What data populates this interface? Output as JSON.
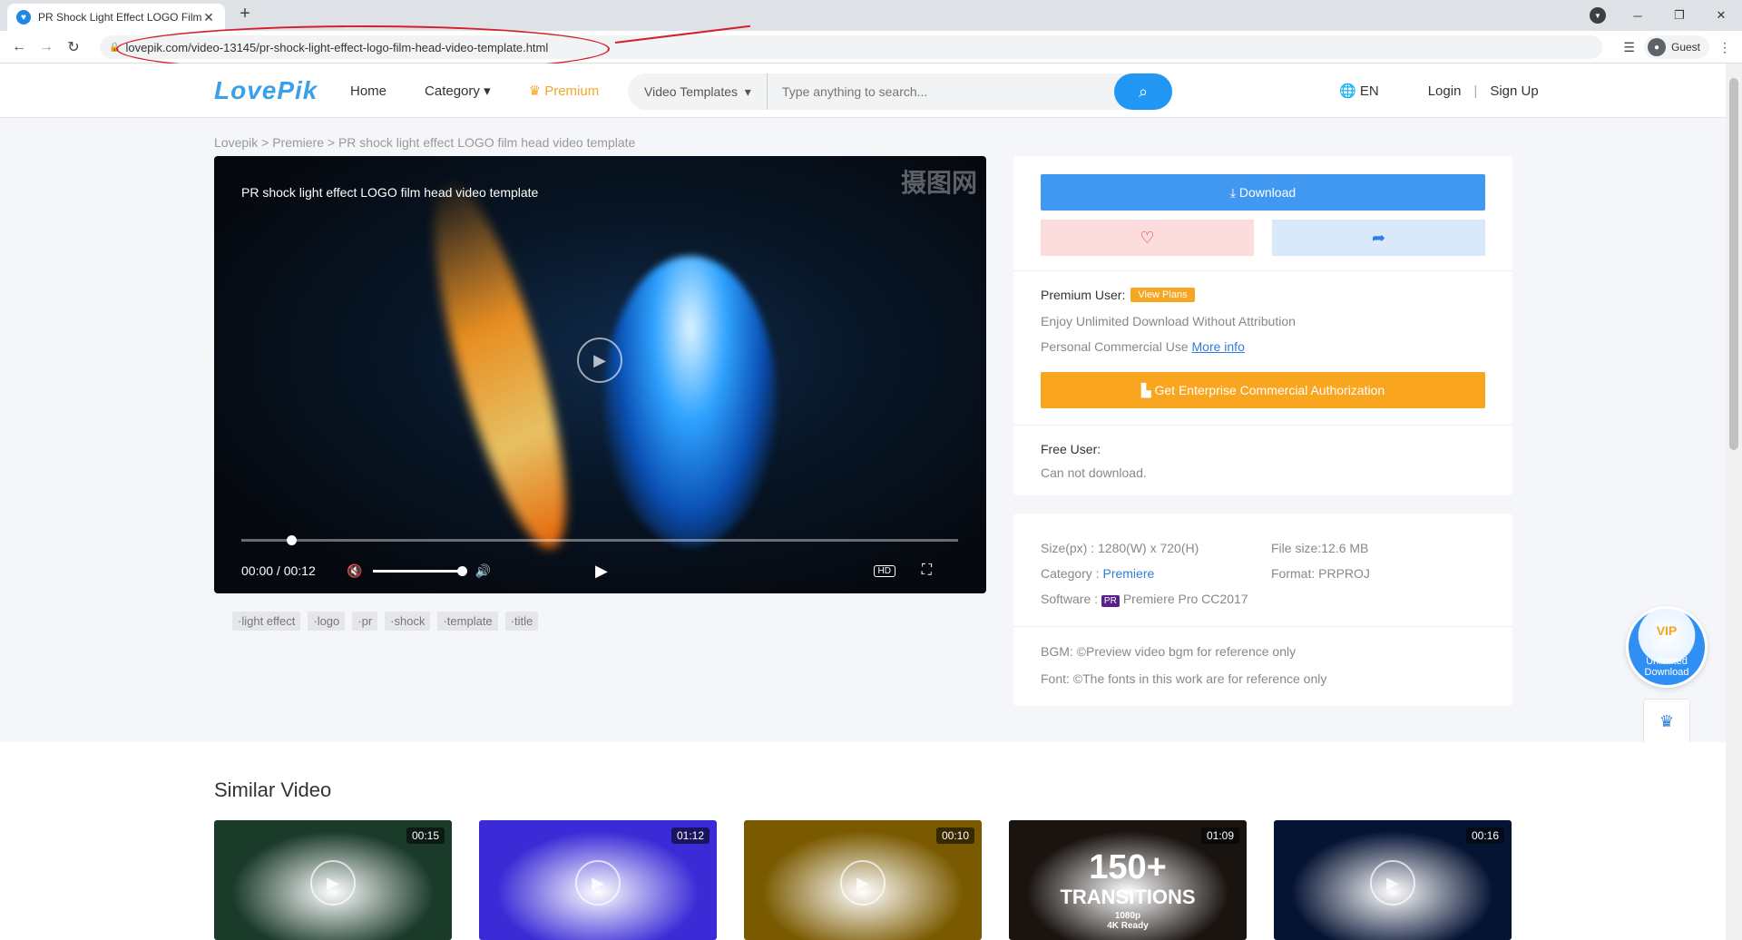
{
  "browser": {
    "tab_title": "PR Shock Light Effect LOGO Film",
    "tab_close": "✕",
    "new_tab": "+",
    "url": "lovepik.com/video-13145/pr-shock-light-effect-logo-film-head-video-template.html",
    "profile": "Guest",
    "annotation_color": "#d4202b"
  },
  "header": {
    "logo": "LovePik",
    "nav": {
      "home": "Home",
      "category": "Category",
      "premium": "Premium"
    },
    "search_type": "Video Templates",
    "search_placeholder": "Type anything to search...",
    "lang": "EN",
    "login": "Login",
    "divider": "|",
    "signup": "Sign Up"
  },
  "breadcrumb": "Lovepik  > Premiere > PR shock light effect LOGO film head video template",
  "player": {
    "title": "PR shock light effect LOGO film head video template",
    "watermark": "摄图网",
    "time_current": "00:00",
    "time_total": "00:12",
    "hd": "HD",
    "progress": 0.07,
    "volume": 1.0
  },
  "tags": [
    "·light effect",
    "·logo",
    "·pr",
    "·shock",
    "·template",
    "·title"
  ],
  "download_panel": {
    "download_label": "Download",
    "premium_user": "Premium User:",
    "view_plans": "View Plans",
    "line1": "Enjoy Unlimited Download Without Attribution",
    "line2": "Personal Commercial Use",
    "more_info": "More info",
    "enterprise": "Get Enterprise Commercial Authorization",
    "free_user": "Free User:",
    "free_note": "Can not download."
  },
  "meta": {
    "size_label": "Size(px) : 1280(W) x 720(H)",
    "file_size": "File size:12.6 MB",
    "category_label": "Category : ",
    "category_value": "Premiere",
    "format": "Format: PRPROJ",
    "software_label": "Software : ",
    "software_icon": "PR",
    "software_value": "Premiere Pro CC2017",
    "bgm": "BGM: ©Preview video bgm for reference only",
    "font": "Font: ©The fonts in this work are for reference only"
  },
  "vip": {
    "badge": "VIP",
    "line1": "Unlimited",
    "line2": "Download"
  },
  "similar": {
    "title": "Similar Video",
    "cards": [
      {
        "duration": "00:15",
        "color": "#1a3a2a"
      },
      {
        "duration": "01:12",
        "color": "#3a2bd6"
      },
      {
        "duration": "00:10",
        "color": "#7a5a00"
      },
      {
        "duration": "01:09",
        "color": "#1a1410",
        "overlay1": "150+",
        "overlay2": "TRANSITIONS",
        "overlay3": "1080p",
        "overlay4": "4K Ready"
      },
      {
        "duration": "00:16",
        "color": "#061434"
      }
    ]
  },
  "icons": {
    "back": "arrow-left-icon",
    "forward": "arrow-right-icon",
    "reload": "reload-icon",
    "search": "search-icon",
    "globe": "globe-icon",
    "heart": "heart-icon",
    "share": "share-icon",
    "crown": "crown-icon",
    "messenger": "messenger-icon"
  }
}
